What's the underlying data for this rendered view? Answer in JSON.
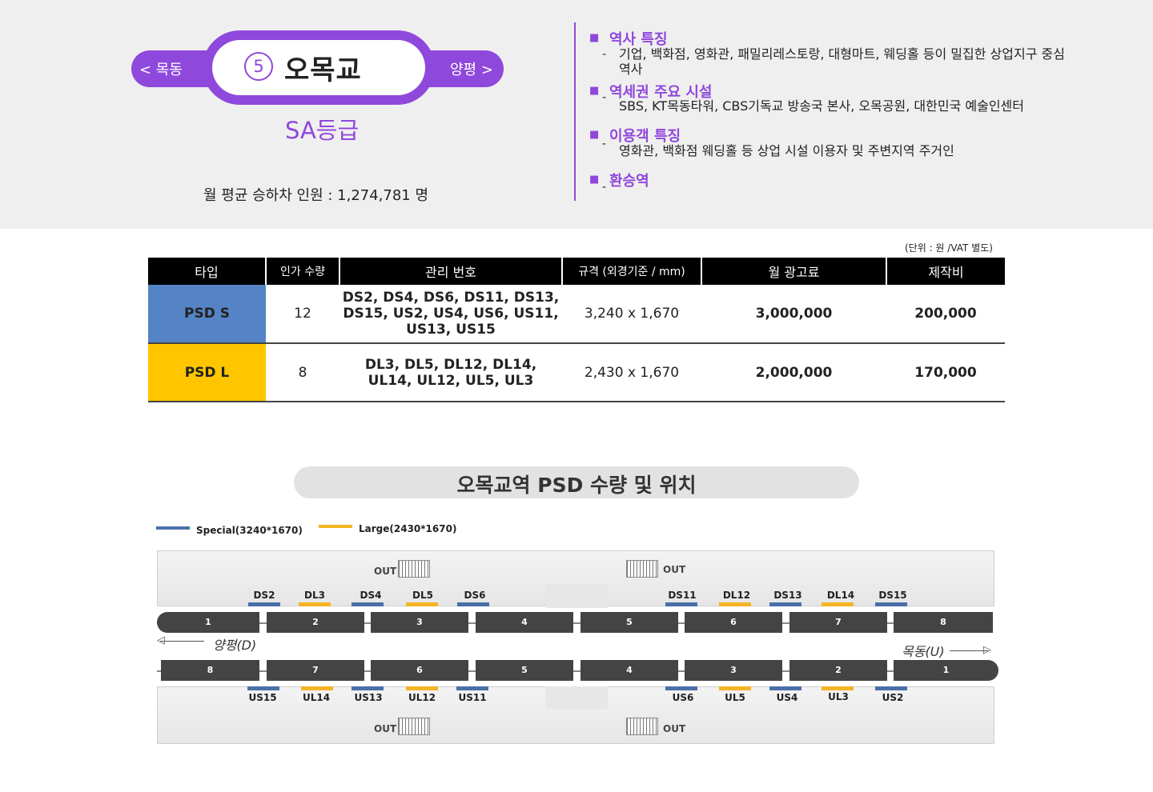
{
  "header": {
    "prev_station": "< 목동",
    "next_station": "양평 >",
    "line_number": "5",
    "station_name": "오목교",
    "grade": "SA등급",
    "monthly_riders": "월 평균 승하차 인원 :  1,274,781 명"
  },
  "features": [
    {
      "title": "역사 특징",
      "text": "기업, 백화점, 영화관, 패밀리레스토랑, 대형마트, 웨딩홀 등이 밀집한 상업지구 중심 역사"
    },
    {
      "title": "역세권 주요 시설",
      "text": "SBS, KT목동타워, CBS기독교 방송국 본사, 오목공원, 대한민국 예술인센터"
    },
    {
      "title": "이용객 특징",
      "text": "영화관, 백화점 웨딩홀 등 상업 시설 이용자 및 주변지역 주거인"
    },
    {
      "title": "환승역",
      "text": ""
    }
  ],
  "colors": {
    "accent": "#8f48dc",
    "psd_s": "#5584c6",
    "psd_l": "#ffc600",
    "price": "#e00000",
    "special_marker": "#4a6ea8",
    "large_marker": "#f4b423"
  },
  "table": {
    "unit_note": "(단위 : 원 /VAT 별도)",
    "headers": [
      "타입",
      "인가 수량",
      "관리 번호",
      "규격 (외경기준 / mm)",
      "월 광고료",
      "제작비"
    ],
    "rows": [
      {
        "type": "PSD S",
        "qty": "12",
        "codes_1": "DS2, DS4, DS6, DS11, DS13,",
        "codes_2": "DS15, US2, US4, US6, US11,",
        "codes_3": "US13, US15",
        "size": "3,240 x 1,670",
        "monthly_fee": "3,000,000",
        "production_cost": "200,000"
      },
      {
        "type": "PSD L",
        "qty": "8",
        "codes_1": "DL3, DL5, DL12, DL14,",
        "codes_2": "UL14, UL12, UL5, UL3",
        "size": "2,430 x 1,670",
        "monthly_fee": "2,000,000",
        "production_cost": "170,000"
      }
    ]
  },
  "map": {
    "title": "오목교역  PSD 수량 및 위치",
    "legend_special": "Special(3240*1670)",
    "legend_large": "Large(2430*1670)",
    "out_label": "OUT",
    "top_doors": [
      "DS2",
      "DL3",
      "DS4",
      "DL5",
      "DS6",
      "DS11",
      "DL12",
      "DS13",
      "DL14",
      "DS15"
    ],
    "bottom_doors": [
      "US15",
      "UL14",
      "US13",
      "UL12",
      "US11",
      "US6",
      "UL5",
      "US4",
      "UL3",
      "US2"
    ],
    "top_cars": [
      "1",
      "2",
      "3",
      "4",
      "5",
      "6",
      "7",
      "8"
    ],
    "bottom_cars": [
      "8",
      "7",
      "6",
      "5",
      "4",
      "3",
      "2",
      "1"
    ],
    "dir_down": "양평(D)",
    "dir_up": "목동(U)"
  }
}
